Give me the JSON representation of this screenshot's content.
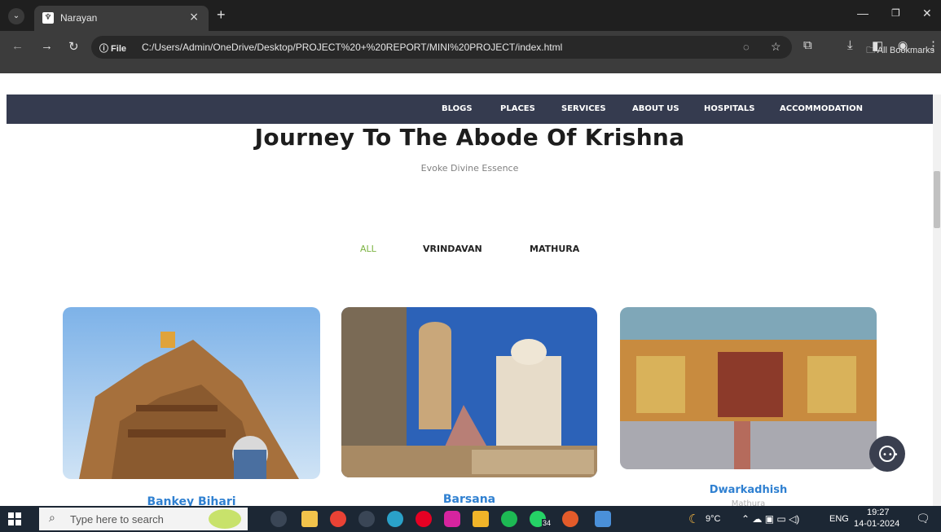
{
  "browser": {
    "tab_title": "Narayan",
    "tab_close": "×",
    "new_tab": "+",
    "file_badge": "ⓘ File",
    "url": "C:/Users/Admin/OneDrive/Desktop/PROJECT%20+%20REPORT/MINI%20PROJECT/index.html",
    "bookmarks_label": "All Bookmarks"
  },
  "nav": {
    "items": [
      "BLOGS",
      "PLACES",
      "SERVICES",
      "ABOUT US",
      "HOSPITALS",
      "ACCOMMODATION"
    ]
  },
  "hero": {
    "title": "Journey To The Abode Of Krishna",
    "subtitle": "Evoke Divine Essence"
  },
  "filters": [
    "ALL",
    "VRINDAVAN",
    "MATHURA"
  ],
  "active_filter": "ALL",
  "cards": [
    {
      "title": "Bankey Bihari",
      "subtitle": ""
    },
    {
      "title": "Barsana",
      "subtitle": ""
    },
    {
      "title": "Dwarkadhish",
      "subtitle": "Mathura"
    }
  ],
  "taskbar": {
    "search_placeholder": "Type here to search",
    "weather": "9°C",
    "lang": "ENG",
    "time": "19:27",
    "date": "14-01-2024",
    "whatsapp_badge": "34"
  },
  "colors": {
    "nav_bg": "#353b4f",
    "accent_green": "#7cb342",
    "card_title_blue": "#2f80d1"
  }
}
